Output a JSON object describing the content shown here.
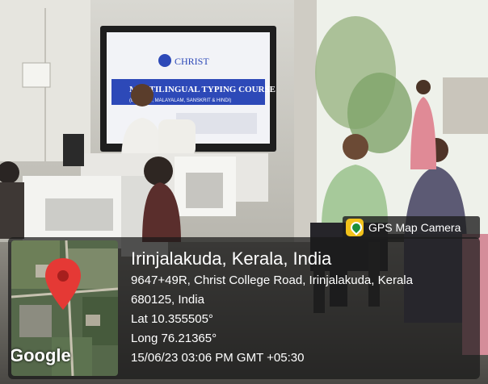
{
  "screen": {
    "slide_logo_text": "CHRIST",
    "slide_title": "MULTILINGUAL TYPING COURSE",
    "slide_subtitle": "(ENGLISH, MALAYALAM, SANSKRIT & HINDI)"
  },
  "stamp": {
    "app_name": "GPS Map Camera",
    "location": "Irinjalakuda, Kerala, India",
    "address_line1": "9647+49R, Christ College Road, Irinjalakuda, Kerala",
    "address_line2": "680125, India",
    "latitude": "Lat 10.355505°",
    "longitude": "Long 76.21365°",
    "datetime": "15/06/23 03:06 PM GMT +05:30",
    "map_brand": "Google"
  },
  "colors": {
    "pin": "#e53935",
    "screen_blue": "#2d49b8",
    "window_light": "#eef1ea"
  }
}
